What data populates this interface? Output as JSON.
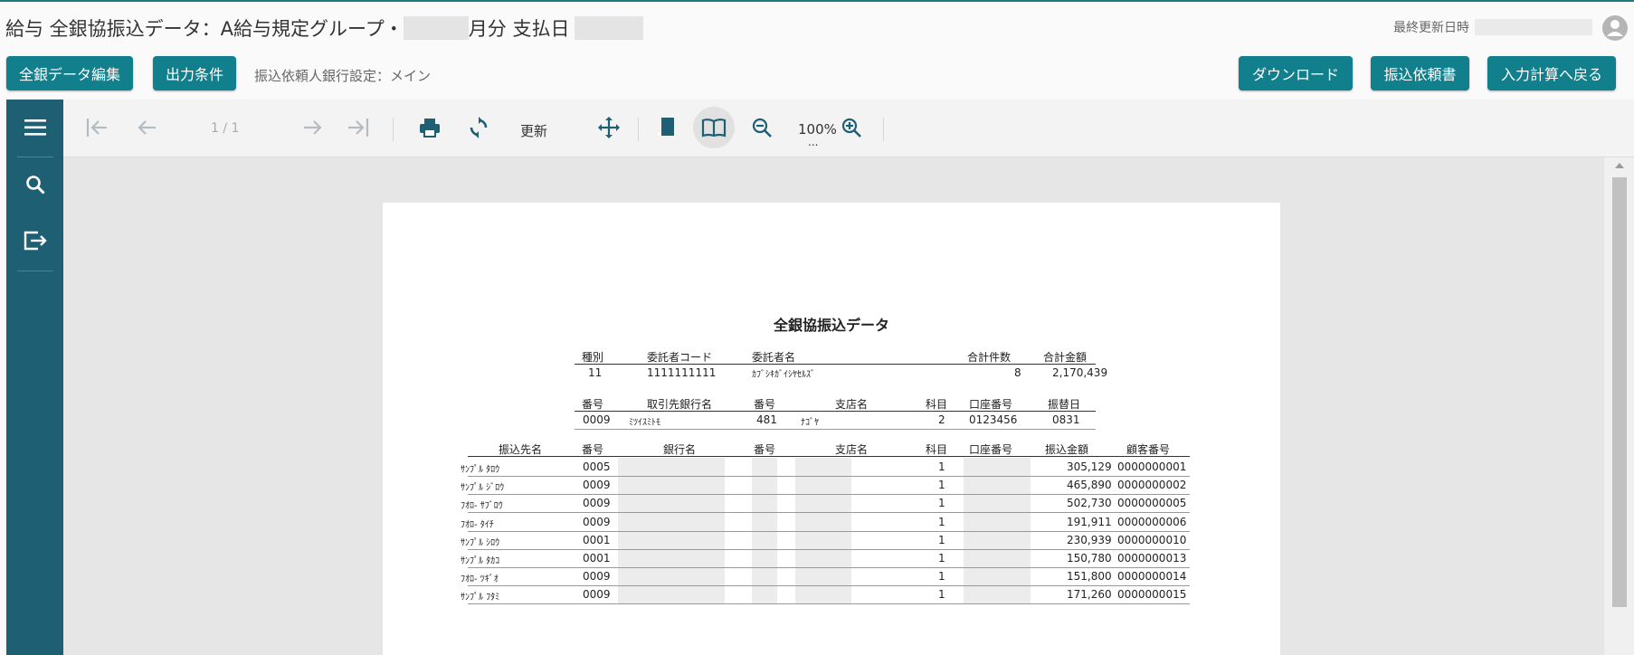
{
  "header": {
    "title_prefix": "給与 全銀協振込データ：A給与規定グループ・",
    "title_month": "月分 支払日",
    "last_updated_label": "最終更新日時"
  },
  "actions": {
    "edit_zengin": "全銀データ編集",
    "output_conditions": "出力条件",
    "bank_setting": "振込依頼人銀行設定：メイン",
    "download": "ダウンロード",
    "transfer_request": "振込依頼書",
    "back_to_input": "入力計算へ戻る"
  },
  "toolbar": {
    "page_indicator": "1 / 1",
    "refresh_label": "更新",
    "zoom": "100%",
    "zoom_more": "..."
  },
  "report": {
    "title": "全銀協振込データ",
    "header1": {
      "cols": [
        "種別",
        "委託者コード",
        "委託者名",
        "合計件数",
        "合計金額"
      ],
      "values": [
        "11",
        "1111111111",
        "ｶﾌﾞｼｷｶﾞｲｼﾔｾﾙｽﾞ",
        "8",
        "2,170,439"
      ]
    },
    "header2": {
      "cols": [
        "番号",
        "取引先銀行名",
        "番号",
        "支店名",
        "科目",
        "口座番号",
        "振替日"
      ],
      "values": [
        "0009",
        "ﾐﾂｲｽﾐﾄﾓ",
        "481",
        "ﾅｺﾞﾔ",
        "2",
        "0123456",
        "0831"
      ]
    },
    "detail_cols": [
      "振込先名",
      "番号",
      "銀行名",
      "番号",
      "支店名",
      "科目",
      "口座番号",
      "振込金額",
      "顧客番号"
    ],
    "rows": [
      {
        "name": "ｻﾝﾌﾟﾙ ﾀﾛｳ",
        "bank_no": "0005",
        "type": "1",
        "amount": "305,129",
        "customer": "0000000001"
      },
      {
        "name": "ｻﾝﾌﾟﾙ ｼﾞﾛｳ",
        "bank_no": "0009",
        "type": "1",
        "amount": "465,890",
        "customer": "0000000002"
      },
      {
        "name": "ﾌｵﾛ- ｻﾌﾞﾛｳ",
        "bank_no": "0009",
        "type": "1",
        "amount": "502,730",
        "customer": "0000000005"
      },
      {
        "name": "ﾌｵﾛ- ﾀｲﾁ",
        "bank_no": "0009",
        "type": "1",
        "amount": "191,911",
        "customer": "0000000006"
      },
      {
        "name": "ｻﾝﾌﾟﾙ ｼﾛｳ",
        "bank_no": "0001",
        "type": "1",
        "amount": "230,939",
        "customer": "0000000010"
      },
      {
        "name": "ｻﾝﾌﾟﾙ ﾀｶｺ",
        "bank_no": "0001",
        "type": "1",
        "amount": "150,780",
        "customer": "0000000013"
      },
      {
        "name": "ﾌｵﾛ- ﾂｷﾞｵ",
        "bank_no": "0009",
        "type": "1",
        "amount": "151,800",
        "customer": "0000000014"
      },
      {
        "name": "ｻﾝﾌﾟﾙ ﾌﾀﾐ",
        "bank_no": "0009",
        "type": "1",
        "amount": "171,260",
        "customer": "0000000015"
      }
    ]
  }
}
